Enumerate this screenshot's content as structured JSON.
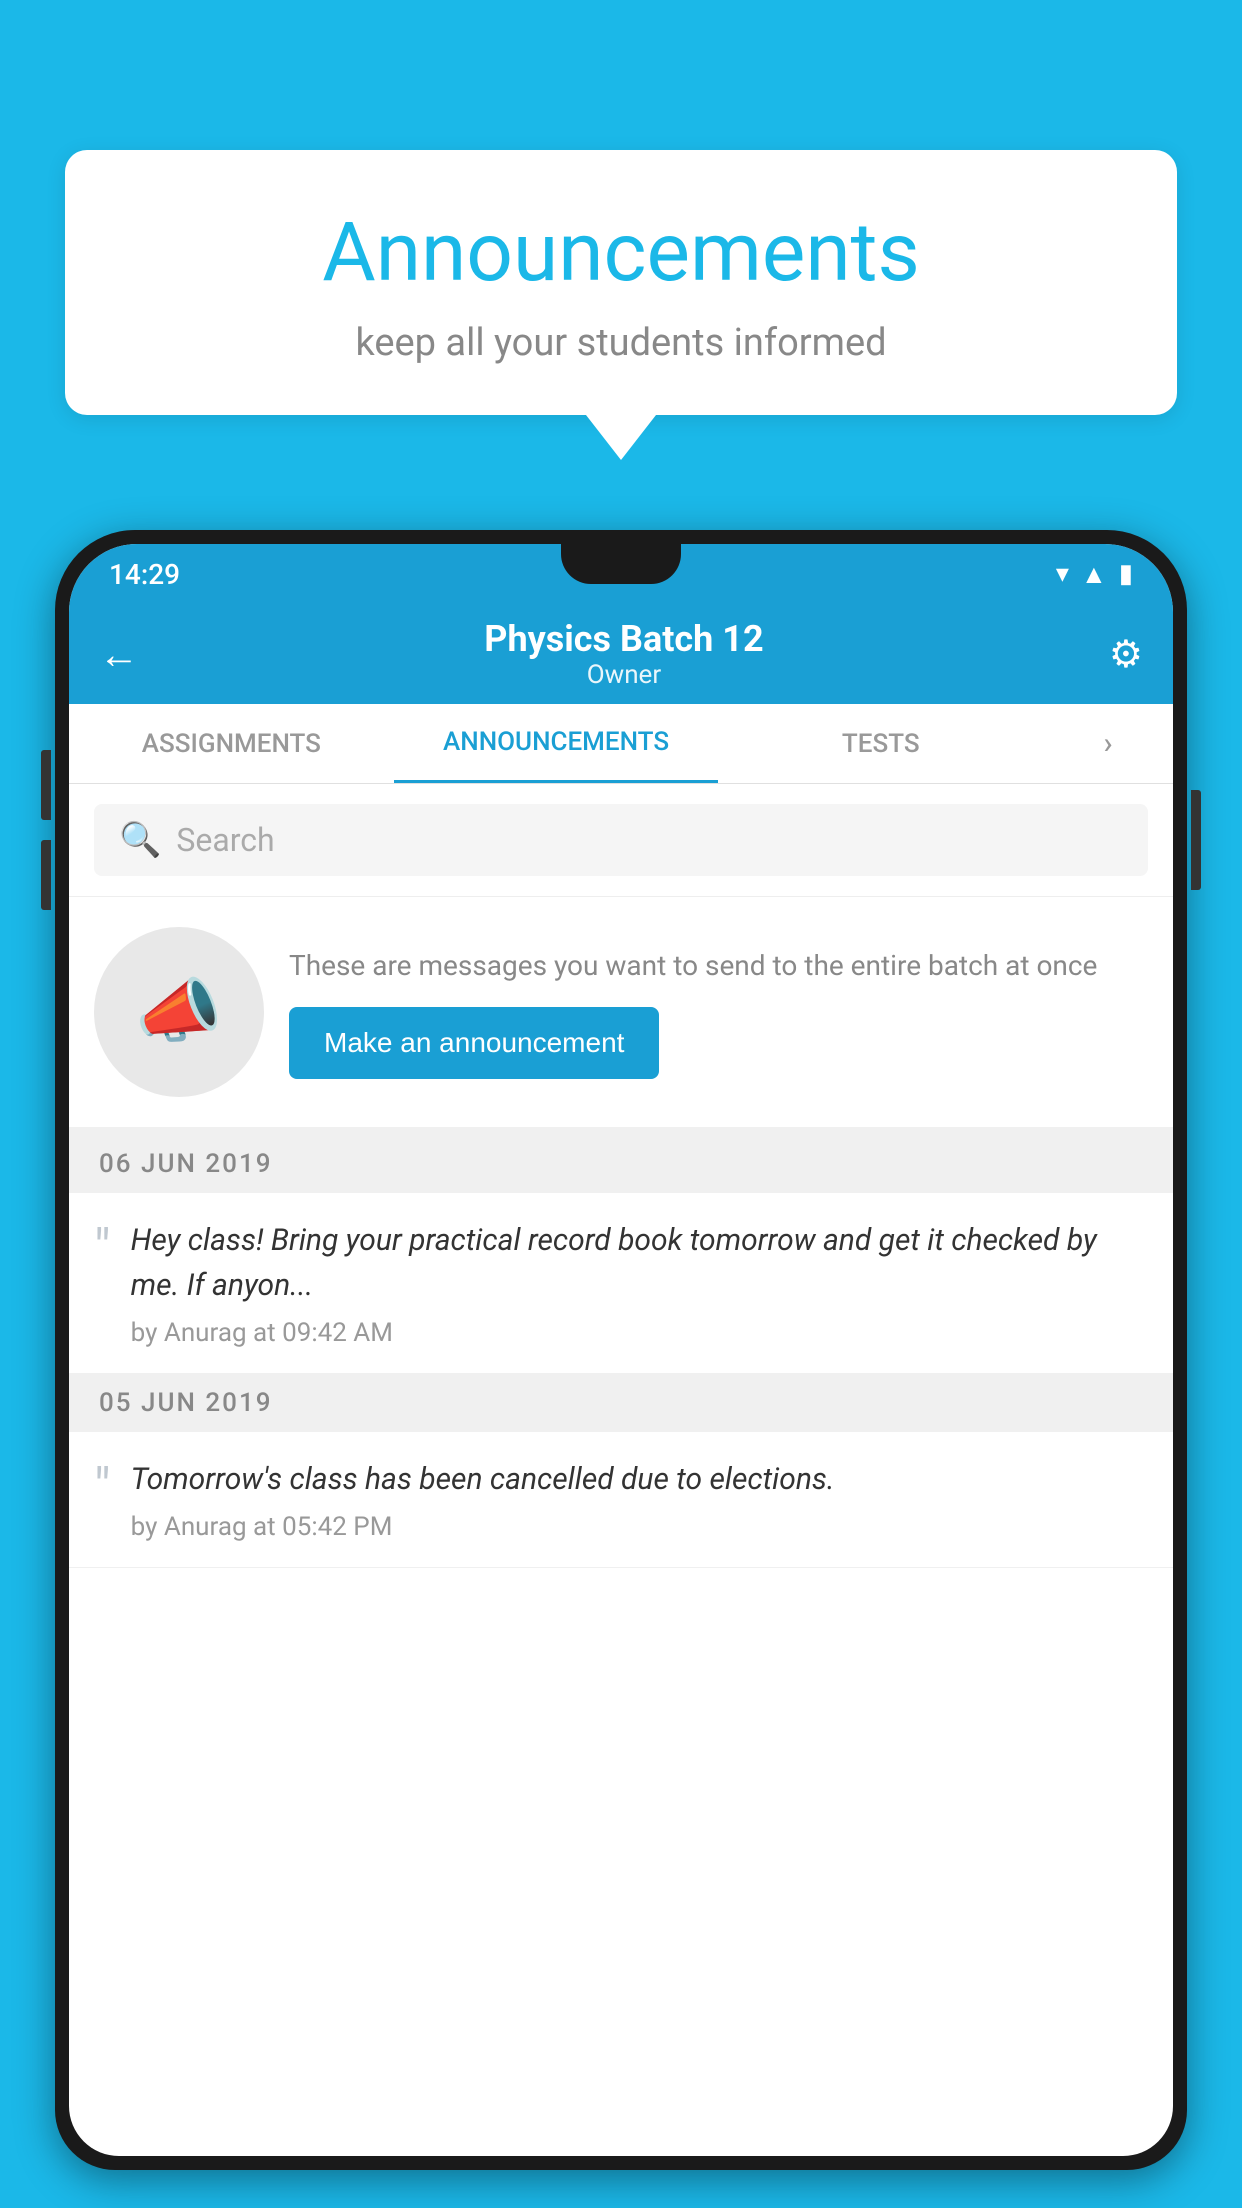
{
  "background_color": "#1BB8E8",
  "speech_bubble": {
    "title": "Announcements",
    "subtitle": "keep all your students informed"
  },
  "phone": {
    "status_bar": {
      "time": "14:29",
      "wifi_icon": "wifi",
      "signal_icon": "signal",
      "battery_icon": "battery"
    },
    "app_bar": {
      "back_label": "←",
      "title": "Physics Batch 12",
      "subtitle": "Owner",
      "gear_label": "⚙"
    },
    "tabs": [
      {
        "label": "ASSIGNMENTS",
        "active": false
      },
      {
        "label": "ANNOUNCEMENTS",
        "active": true
      },
      {
        "label": "TESTS",
        "active": false
      },
      {
        "label": "›",
        "active": false
      }
    ],
    "search": {
      "placeholder": "Search"
    },
    "promo": {
      "description": "These are messages you want to send to the entire batch at once",
      "button_label": "Make an announcement"
    },
    "announcements": [
      {
        "date": "06  JUN  2019",
        "text": "Hey class! Bring your practical record book tomorrow and get it checked by me. If anyon...",
        "meta": "by Anurag at 09:42 AM"
      },
      {
        "date": "05  JUN  2019",
        "text": "Tomorrow's class has been cancelled due to elections.",
        "meta": "by Anurag at 05:42 PM"
      }
    ]
  }
}
